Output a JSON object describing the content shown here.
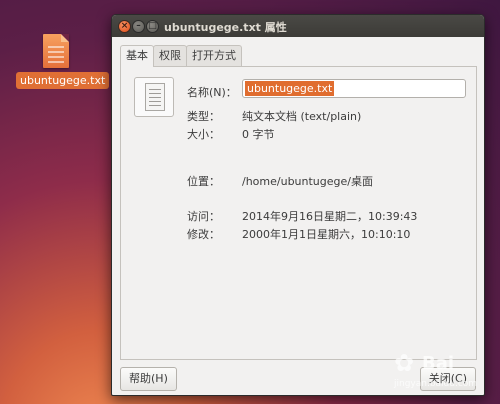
{
  "desktop": {
    "file_label": "ubuntugege.txt"
  },
  "window": {
    "title": "ubuntugege.txt 属性",
    "close_glyph": "×",
    "min_glyph": "–",
    "max_glyph": "□"
  },
  "tabs": [
    {
      "label": "基本"
    },
    {
      "label": "权限"
    },
    {
      "label": "打开方式"
    }
  ],
  "fields": {
    "name_label": "名称(N)：",
    "name_value": "ubuntugege.txt",
    "type_label": "类型：",
    "type_value": "纯文本文档 (text/plain)",
    "size_label": "大小：",
    "size_value": "0 字节",
    "location_label": "位置：",
    "location_value": "/home/ubuntugege/桌面",
    "accessed_label": "访问：",
    "accessed_value": "2014年9月16日星期二，10:39:43",
    "modified_label": "修改：",
    "modified_value": "2000年1月1日星期六，10:10:10"
  },
  "buttons": {
    "help": "帮助(H)",
    "close": "关闭(C)"
  },
  "watermark": {
    "logo": "Bai",
    "url": "jingyan.baidu.com"
  }
}
